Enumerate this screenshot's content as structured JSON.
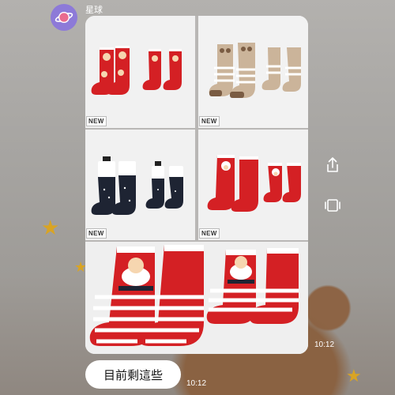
{
  "chat": {
    "sender_name": "星球",
    "album": {
      "items": [
        {
          "badge": "NEW"
        },
        {
          "badge": "NEW"
        },
        {
          "badge": "NEW"
        },
        {
          "badge": "NEW"
        },
        {
          "badge": ""
        }
      ],
      "timestamp": "10:12"
    },
    "message": {
      "text": "目前剩這些",
      "timestamp": "10:12"
    }
  },
  "side_actions": [
    "share-icon",
    "keep-icon"
  ],
  "colors": {
    "sock_red": "#d42024",
    "sock_navy": "#1e2433",
    "sock_beige": "#cbb49a",
    "star_gold": "#d9a423",
    "avatar_purple": "#8d7ad8"
  }
}
